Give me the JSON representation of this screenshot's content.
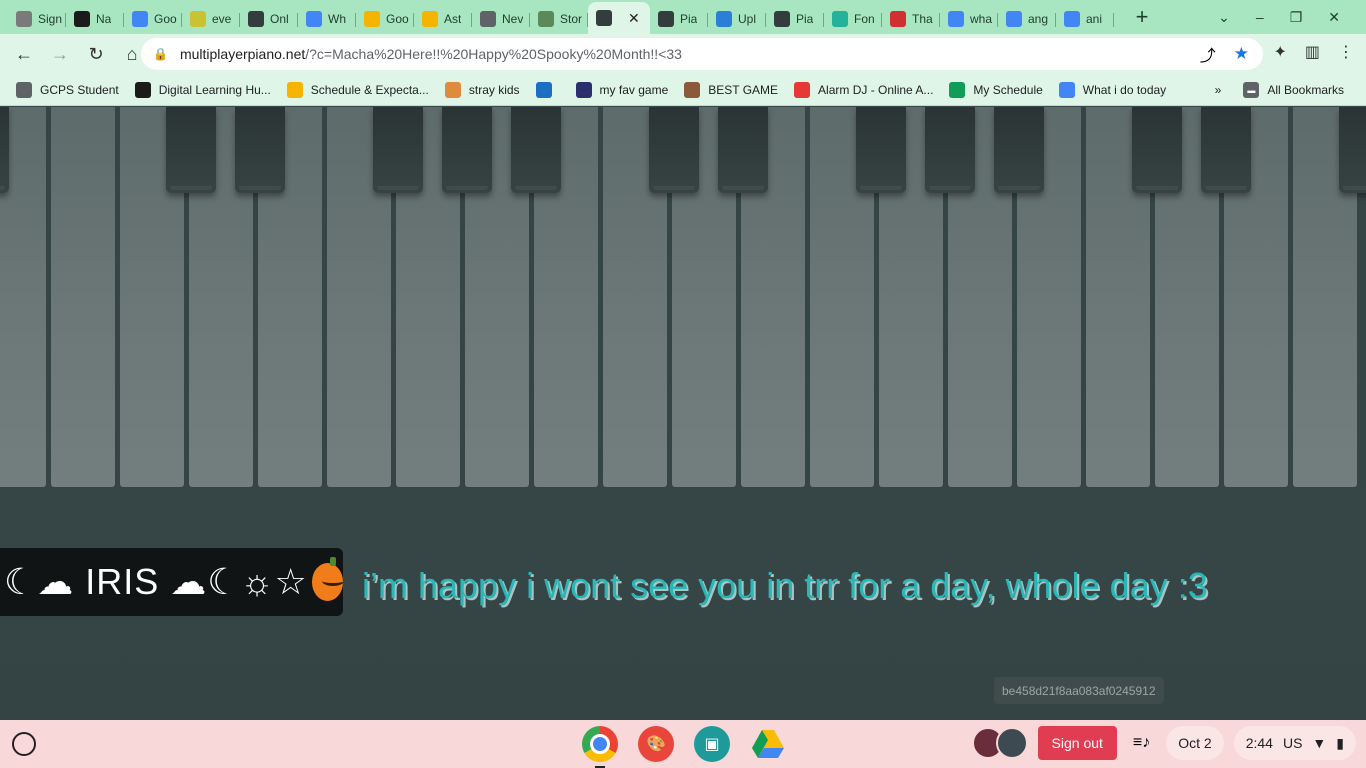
{
  "browser": {
    "tabs": [
      {
        "title": "Sign",
        "icon": "globe-icon",
        "color": "#7a7a7a"
      },
      {
        "title": "Na",
        "icon": "d2l-icon",
        "color": "#1b1b1b"
      },
      {
        "title": "Goo",
        "icon": "docs-icon",
        "color": "#4285f4"
      },
      {
        "title": "eve",
        "icon": "music-note-icon",
        "color": "#c9c232"
      },
      {
        "title": "Onl",
        "icon": "keyboard-icon",
        "color": "#333d3d"
      },
      {
        "title": "Wh",
        "icon": "docs-icon",
        "color": "#4285f4"
      },
      {
        "title": "Goo",
        "icon": "slides-icon",
        "color": "#f4b400"
      },
      {
        "title": "Ast",
        "icon": "slides-icon",
        "color": "#f4b400"
      },
      {
        "title": "Nev",
        "icon": "chrome-icon",
        "color": "#5f6368"
      },
      {
        "title": "Stor",
        "icon": "plant-icon",
        "color": "#5a8a5a"
      },
      {
        "title": "",
        "icon": "piano-icon",
        "color": "#333d3d",
        "active": true
      },
      {
        "title": "Pia",
        "icon": "piano-icon",
        "color": "#333d3d"
      },
      {
        "title": "Upl",
        "icon": "ibb-icon",
        "color": "#2a80d6"
      },
      {
        "title": "Pia",
        "icon": "piano-icon",
        "color": "#333d3d"
      },
      {
        "title": "Fon",
        "icon": "font-icon",
        "color": "#25b29a"
      },
      {
        "title": "Tha",
        "icon": "got-icon",
        "color": "#d13030"
      },
      {
        "title": "wha",
        "icon": "google-icon",
        "color": "#4285f4"
      },
      {
        "title": "ang",
        "icon": "google-icon",
        "color": "#4285f4"
      },
      {
        "title": "ani",
        "icon": "google-icon",
        "color": "#4285f4"
      }
    ],
    "url_host": "multiplayerpiano.net",
    "url_path": "/?c=Macha%20Here!!%20Happy%20Spooky%20Month!!<33",
    "bookmarks": [
      {
        "label": "GCPS Student",
        "icon": "calendar-icon",
        "color": "#5f6368"
      },
      {
        "label": "Digital Learning Hu...",
        "icon": "d2l-icon",
        "color": "#1b1b1b"
      },
      {
        "label": "Schedule & Expecta...",
        "icon": "slides-icon",
        "color": "#f4b400"
      },
      {
        "label": "stray kids",
        "icon": "p-icon",
        "color": "#e08a3c"
      },
      {
        "label": "",
        "icon": "edge-icon",
        "color": "#1b6fc2"
      },
      {
        "label": "my fav game",
        "icon": "game-icon",
        "color": "#2b2f6b"
      },
      {
        "label": "BEST GAME",
        "icon": "face-icon",
        "color": "#8a5a3a"
      },
      {
        "label": "Alarm DJ - Online A...",
        "icon": "alarm-icon",
        "color": "#e53935"
      },
      {
        "label": "My Schedule",
        "icon": "sheets-icon",
        "color": "#0f9d58"
      },
      {
        "label": "What i do today",
        "icon": "docs-icon",
        "color": "#4285f4"
      }
    ],
    "all_bookmarks_label": "All Bookmarks"
  },
  "piano": {
    "white_key_count": 20,
    "black_key_positions": [
      0,
      3,
      4,
      6,
      7,
      8,
      10,
      11,
      13,
      14,
      15,
      17,
      18,
      20
    ]
  },
  "chat": {
    "user_name": "☾☁ IRIS ☁☾☼☆",
    "message": "i’m happy i wont see you in trr for a day, whole day :3"
  },
  "user_id": "be458d21f8aa083af0245912",
  "shelf": {
    "apps": [
      "chrome-icon",
      "paint-icon",
      "classroom-icon",
      "drive-icon"
    ],
    "signout_label": "Sign out",
    "date": "Oct 2",
    "time": "2:44",
    "locale": "US"
  }
}
